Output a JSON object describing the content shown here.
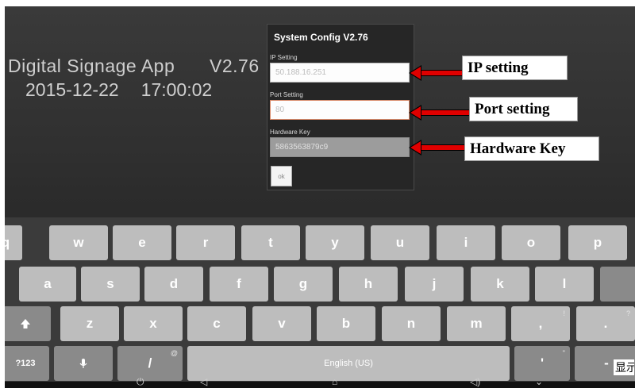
{
  "app": {
    "name": "Digital Signage App",
    "version": "V2.76",
    "date": "2015-12-22",
    "time": "17:00:02"
  },
  "dialog": {
    "title": "System Config V2.76",
    "ip_label": "IP Setting",
    "ip_value": "50.188.16.251",
    "port_label": "Port Setting",
    "port_value": "80",
    "hwkey_label": "Hardware Key",
    "hwkey_value": "5863563879c9",
    "ok_label": "ok"
  },
  "callouts": {
    "ip": "IP setting",
    "port": "Port setting",
    "hwkey": "Hardware Key"
  },
  "keyboard": {
    "row1": [
      "q",
      "w",
      "e",
      "r",
      "t",
      "y",
      "u",
      "i",
      "o",
      "p"
    ],
    "row2": [
      "a",
      "s",
      "d",
      "f",
      "g",
      "h",
      "j",
      "k",
      "l"
    ],
    "row3": [
      "z",
      "x",
      "c",
      "v",
      "b",
      "n",
      "m",
      ",",
      "."
    ],
    "row3_hints": [
      "!",
      "?"
    ],
    "shift_icon": "shift-icon",
    "symbols": "?123",
    "mic_icon": "mic-icon",
    "slash": "/",
    "slash_hint": "@",
    "space": "English (US)",
    "apostrophe": "'",
    "apostrophe_hint": "\"",
    "dash": "-"
  },
  "navbar": {
    "icons": [
      "power-icon",
      "volume-down-icon",
      "home-icon",
      "volume-up-icon",
      "hide-keyboard-icon"
    ]
  },
  "ime_tag": "显示"
}
